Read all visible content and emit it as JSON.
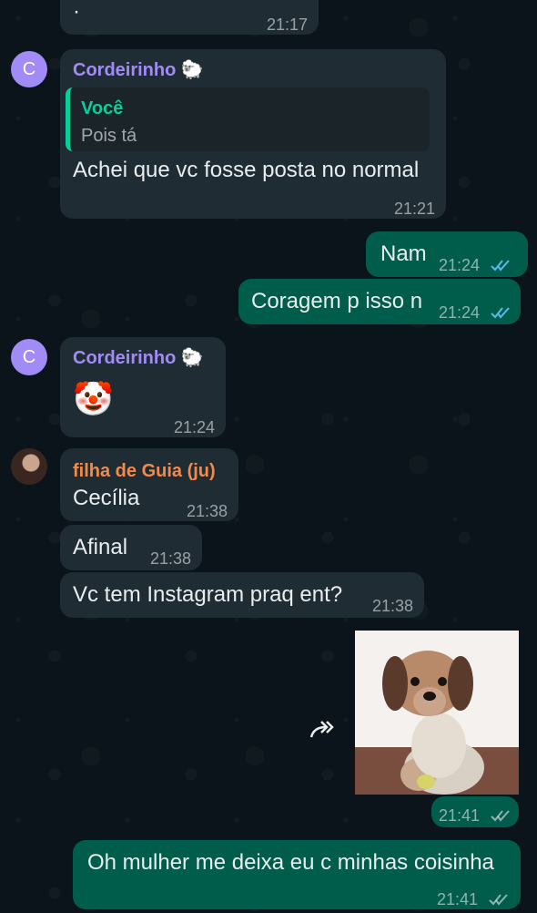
{
  "messages": [
    {
      "text": "·",
      "time": "21:17"
    },
    {
      "sender": "Cordeirinho 🐑",
      "avatar": "C",
      "quote": {
        "author": "Você",
        "text": "Pois tá"
      },
      "text": "Achei que vc fosse posta no normal",
      "time": "21:21"
    },
    {
      "text": "Nam",
      "time": "21:24"
    },
    {
      "text": "Coragem p isso n",
      "time": "21:24"
    },
    {
      "sender": "Cordeirinho 🐑",
      "avatar": "C",
      "text": "🤡",
      "time": "21:24"
    },
    {
      "sender": "filha de Guia (ju)",
      "text": "Cecília",
      "time": "21:38"
    },
    {
      "text": "Afinal",
      "time": "21:38"
    },
    {
      "text": "Vc tem Instagram praq ent?",
      "time": "21:38"
    },
    {
      "image_icon": "puppy-sticker",
      "time": "21:41"
    },
    {
      "text": "Oh mulher me deixa eu c minhas coisinha",
      "time": "21:41"
    }
  ],
  "colors": {
    "background": "#0b141a",
    "incoming": "#202c33",
    "outgoing": "#005c4b",
    "sender_purple": "#a18cf7",
    "sender_orange": "#f28a4a",
    "quote_green": "#06cf9c",
    "read_tick": "#53bdeb"
  }
}
